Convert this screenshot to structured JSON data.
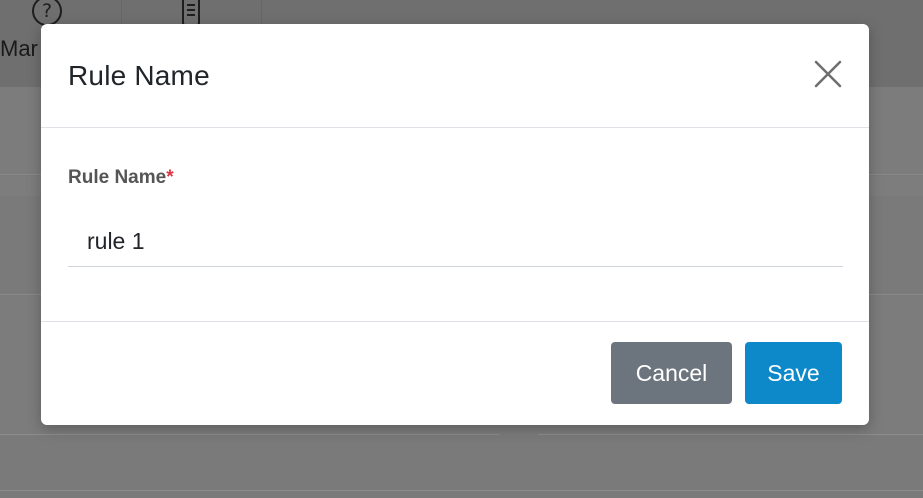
{
  "background": {
    "help_label": "Mar",
    "help_icon": "?"
  },
  "modal": {
    "title": "Rule Name",
    "field": {
      "label": "Rule Name",
      "required_marker": "*",
      "value": "rule 1"
    },
    "buttons": {
      "cancel": "Cancel",
      "save": "Save"
    },
    "icons": {
      "close": "close-icon"
    }
  },
  "colors": {
    "save_button": "#0d88c9",
    "cancel_button": "#6c757d",
    "required": "#dc3545"
  }
}
